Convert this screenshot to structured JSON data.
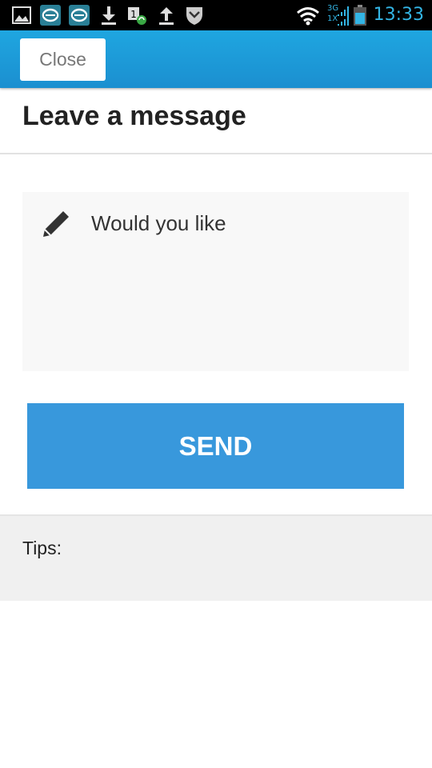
{
  "status_bar": {
    "time": "13:33",
    "network_label": "3G",
    "network_sub_label": "1X",
    "icons": [
      "image-icon",
      "app-badge-icon",
      "app-badge-icon",
      "download-icon",
      "sync-icon",
      "upload-icon",
      "shield-icon",
      "wifi-icon",
      "signal-icon",
      "battery-icon"
    ],
    "accent_color": "#33b5e5"
  },
  "app_bar": {
    "close_label": "Close",
    "color": "#1fa6e0"
  },
  "header": {
    "title": "Leave a message"
  },
  "message": {
    "placeholder": "Would you like",
    "icon": "pencil-icon"
  },
  "send": {
    "label": "SEND",
    "color": "#3898dc"
  },
  "tips": {
    "label": "Tips:"
  }
}
